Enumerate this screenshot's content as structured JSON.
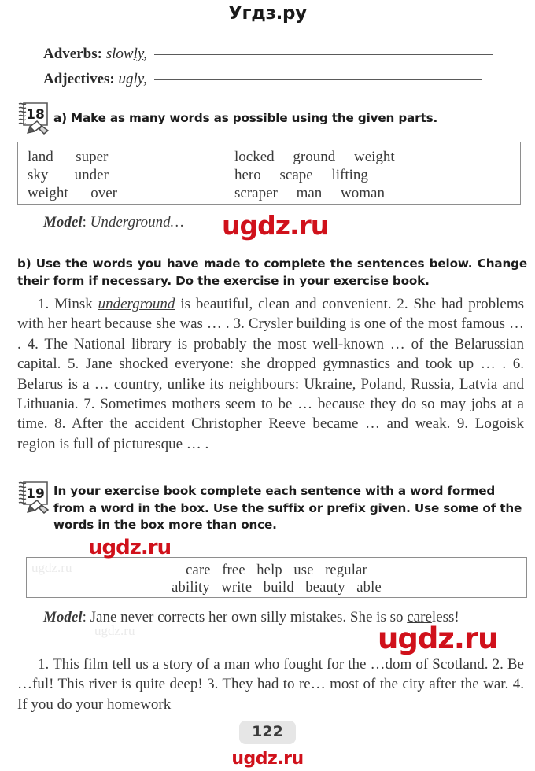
{
  "watermarks": {
    "top": "Угдз.ру",
    "model_overlay": "ugdz.ru",
    "box19_overlay": "ugdz.ru",
    "lower_overlay": "ugdz.ru",
    "footer": "ugdz.ru",
    "ghost_left": "ugdz.ru",
    "accent_color": "#d0111b"
  },
  "header": {
    "adverbs_label": "Adverbs:",
    "adverbs_example_pre": "slow",
    "adverbs_example_underlined": "ly",
    "adverbs_example_post": ",",
    "adjectives_label": "Adjectives:",
    "adjectives_example": "ugly",
    "adjectives_example_post": ","
  },
  "exercise18": {
    "number": "18",
    "title_a": "a) Make as many words as possible using the given parts.",
    "wordbox": {
      "left_column": [
        "land      super",
        "sky       under",
        "weight      over"
      ],
      "right_column": [
        "locked     ground     weight",
        "hero     scape     lifting",
        "scraper     man     woman"
      ]
    },
    "model_label": "Model",
    "model_sep": ": ",
    "model_text": "Underground…",
    "title_b": "b) Use the words you have made to complete the sentences below. Change their form if necessary. Do the exercise in your exercise book.",
    "sentences_pre": "1. Minsk ",
    "sentences_underlined": "underground",
    "sentences_post": " is beautiful, clean and convenient. 2. She had problems with her heart because she was … . 3. Crysler building is one of the most famous … . 4. The National library is probably the most well-known … of the Belarussian capital. 5. Jane shocked everyone: she dropped gymnastics and took up … . 6. Belarus is a … country, unlike its neighbours: Ukraine, Poland, Russia, Latvia and Lithuania. 7. Sometimes mothers seem to be … because they do so may jobs at a time. 8. After the accident Christopher Reeve became … and weak. 9. Logoisk region is full of picturesque … ."
  },
  "exercise19": {
    "number": "19",
    "title": "In your exercise book complete each sentence with a word formed from a word in the box. Use the suffix or prefix given. Use some of the words in the box more than once.",
    "wordbox": {
      "row1": "care   free   help   use   regular",
      "row2": "ability   write   build   beauty   able"
    },
    "model_label": "Model",
    "model_sep": ": ",
    "model_text": "Jane never corrects her own silly mistakes. She is so ",
    "model_underlined": "care",
    "model_tail": "less!",
    "sentences": "1. This film tell us a story of a man who fought for the …dom of Scotland. 2. Be …ful! This river is quite deep! 3. They had to re… most of the city after the war. 4. If you do your homework"
  },
  "footer": {
    "page_number": "122"
  }
}
